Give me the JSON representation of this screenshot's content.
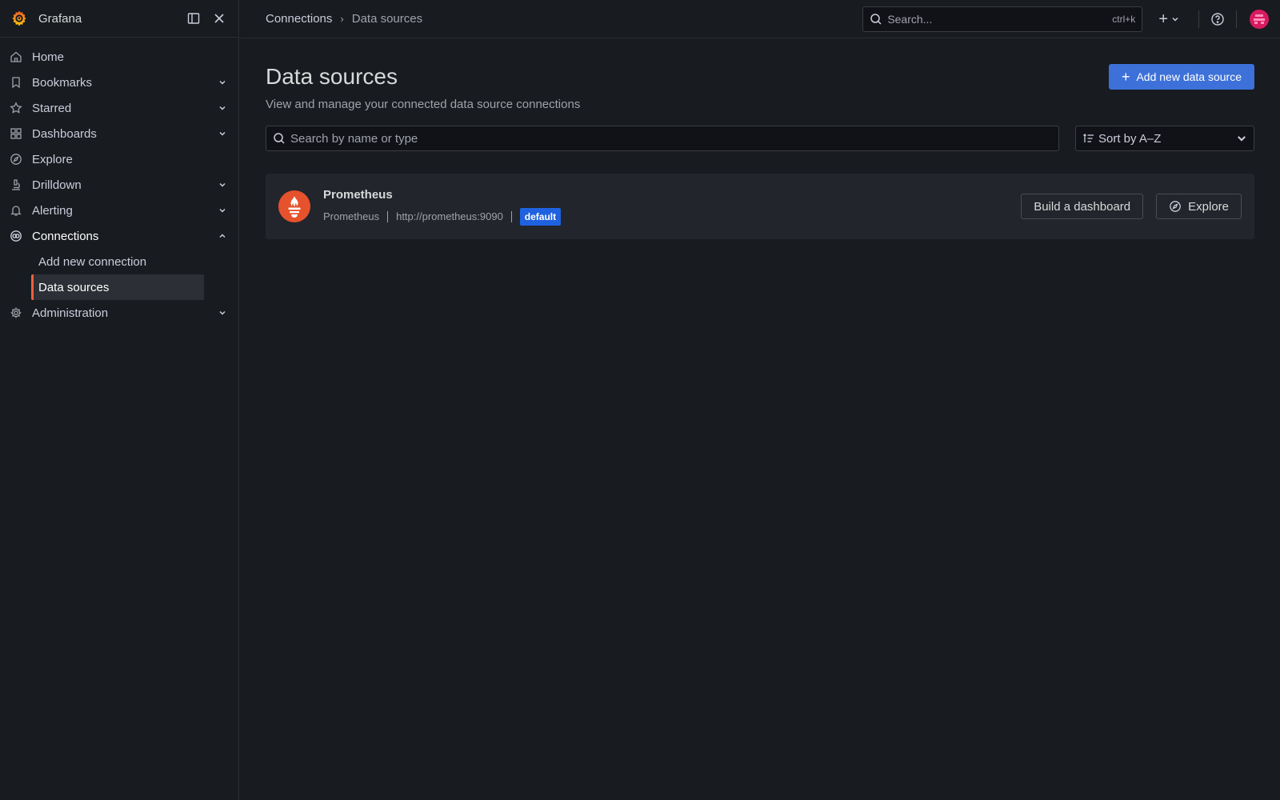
{
  "app": {
    "name": "Grafana"
  },
  "sidebar": {
    "items": [
      {
        "label": "Home",
        "icon": "home-icon"
      },
      {
        "label": "Bookmarks",
        "icon": "bookmark-icon"
      },
      {
        "label": "Starred",
        "icon": "star-icon"
      },
      {
        "label": "Dashboards",
        "icon": "apps-icon"
      },
      {
        "label": "Explore",
        "icon": "compass-icon"
      },
      {
        "label": "Drilldown",
        "icon": "microscope-icon"
      },
      {
        "label": "Alerting",
        "icon": "bell-icon"
      },
      {
        "label": "Connections",
        "icon": "connections-icon"
      },
      {
        "label": "Administration",
        "icon": "cog-icon"
      }
    ],
    "sub_items": [
      {
        "label": "Add new connection"
      },
      {
        "label": "Data sources"
      }
    ]
  },
  "topbar": {
    "breadcrumb": [
      "Connections",
      "Data sources"
    ],
    "search_placeholder": "Search...",
    "search_shortcut": "ctrl+k"
  },
  "page": {
    "title": "Data sources",
    "subtitle": "View and manage your connected data source connections",
    "add_button": "Add new data source",
    "search_placeholder": "Search by name or type",
    "sort_value": "Sort by A–Z"
  },
  "datasources": [
    {
      "name": "Prometheus",
      "type": "Prometheus",
      "url": "http://prometheus:9090",
      "badge": "default",
      "build_button": "Build a dashboard",
      "explore_button": "Explore"
    }
  ],
  "colors": {
    "accent_primary": "#3d71d9",
    "active_indicator": "#f55f3e",
    "badge": "#1f62e0",
    "prometheus": "#e6522c"
  }
}
